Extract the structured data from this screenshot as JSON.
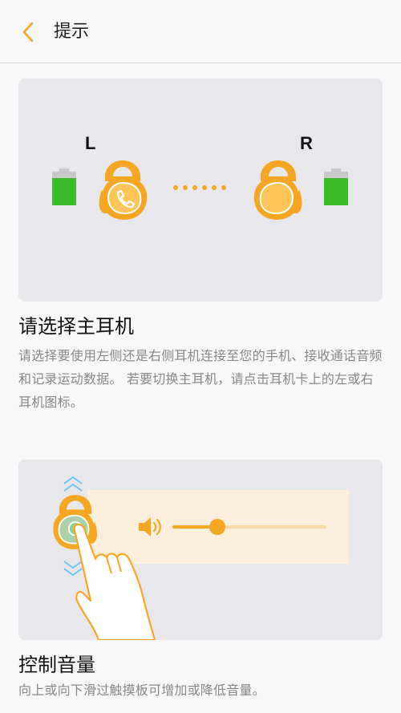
{
  "header": {
    "title": "提示",
    "back_icon": "chevron-left-icon",
    "accent_color": "#f5a623"
  },
  "card_earbuds": {
    "left_label": "L",
    "right_label": "R",
    "battery_color": "#3cbd2a",
    "earbud_color": "#f5a623",
    "left_earbud_icon": "phone-icon",
    "left_battery_level": 1.0,
    "right_battery_level": 1.0
  },
  "section1": {
    "title": "请选择主耳机",
    "description": "请选择要使用左侧还是右侧耳机连接至您的手机、接收通话音频和记录运动数据。 若要切换主耳机，请点击耳机卡上的左或右耳机图标。"
  },
  "card_volume": {
    "speaker_icon": "volume-icon",
    "slider_level": 0.29,
    "gesture_icon": "swipe-hand-icon"
  },
  "section2": {
    "title": "控制音量",
    "description": "向上或向下滑过触摸板可增加或降低音量。"
  }
}
